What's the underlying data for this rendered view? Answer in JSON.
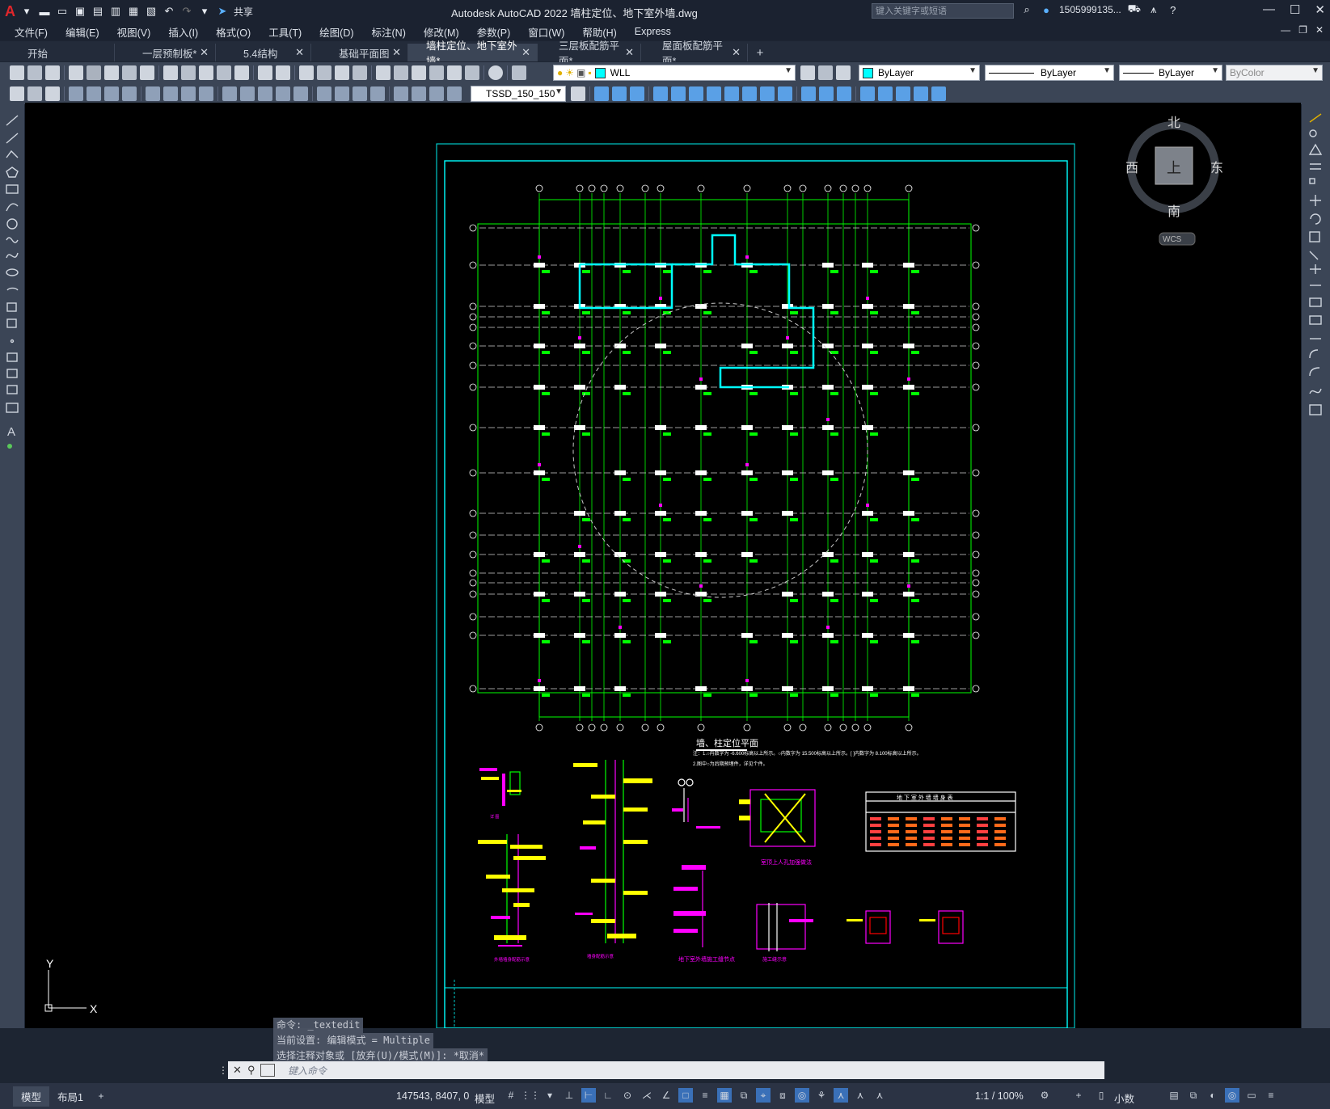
{
  "app": {
    "title": "Autodesk AutoCAD 2022    墙柱定位、地下室外墙.dwg",
    "search_placeholder": "键入关键字或短语",
    "user": "1505999135...",
    "share": "共享"
  },
  "menu": [
    "文件(F)",
    "编辑(E)",
    "视图(V)",
    "插入(I)",
    "格式(O)",
    "工具(T)",
    "绘图(D)",
    "标注(N)",
    "修改(M)",
    "参数(P)",
    "窗口(W)",
    "帮助(H)",
    "Express"
  ],
  "tabs": [
    {
      "label": "开始",
      "closable": false,
      "active": false
    },
    {
      "label": "一层预制板*",
      "closable": true,
      "active": false
    },
    {
      "label": "5.4结构",
      "closable": true,
      "active": false
    },
    {
      "label": "基础平面图",
      "closable": true,
      "active": false
    },
    {
      "label": "墙柱定位、地下室外墙*",
      "closable": true,
      "active": true
    },
    {
      "label": "三层板配筋平面*",
      "closable": true,
      "active": false
    },
    {
      "label": "屋面板配筋平面*",
      "closable": true,
      "active": false
    }
  ],
  "toolbar": {
    "layer": "WLL",
    "color": "ByLayer",
    "linetype": "ByLayer",
    "lineweight": "ByLayer",
    "plotstyle": "ByColor",
    "textstyle": "TSSD_150_150"
  },
  "viewcube": {
    "north": "北",
    "south": "南",
    "east": "东",
    "west": "西",
    "top": "上",
    "wcs": "WCS"
  },
  "drawing": {
    "plan_title": "墙、柱定位平面",
    "note": "注：1.○内数字为 -6.600标高以上所示。○内数字为 15.500标高以上所示。[ ]内数字为 8.100标高以上所示。",
    "note2": "2.图中○为后期预埋件，详见个件。",
    "table_title": "地 下 室 外 墙 墙 身 表",
    "detail_1": "外墙墙身配筋示意",
    "detail_2": "墙身配筋示意",
    "detail_3": "室顶上人孔加强做法",
    "detail_4": "地下室外墙施工缝节点"
  },
  "ucs": {
    "y": "Y",
    "x": "X"
  },
  "command": {
    "history": [
      "命令: _textedit",
      "当前设置: 编辑模式 = Multiple",
      "选择注释对象或 [放弃(U)/模式(M)]: *取消*"
    ],
    "placeholder": "键入命令"
  },
  "status": {
    "model_tab": "模型",
    "layout_tab": "布局1",
    "coords": "147543, 8407, 0",
    "space": "模型",
    "scale": "1:1 / 100%",
    "units": "小数"
  },
  "colors": {
    "accent": "#00c8c8",
    "grid_green": "#00ff00",
    "magenta": "#ff00ff",
    "yellow": "#ffff00",
    "cyan": "#00ffff"
  }
}
